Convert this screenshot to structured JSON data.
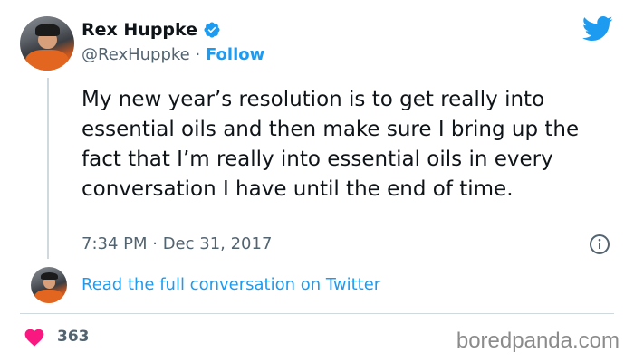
{
  "tweet": {
    "author_name": "Rex Huppke",
    "handle": "@RexHuppke",
    "separator": "·",
    "follow_label": "Follow",
    "text": "My new year’s resolution is to get really into essential oils and then make sure I bring up the fact that I’m really into essential oils in every conversation I have until the end of time.",
    "timestamp": "7:34 PM · Dec 31, 2017",
    "read_full_label": "Read the full conversation on Twitter",
    "like_count": "363"
  },
  "watermark": "boredpanda.com",
  "icons": {
    "verified": "verified-badge-icon",
    "brand": "twitter-bird-icon",
    "info": "info-icon",
    "like": "heart-icon"
  },
  "colors": {
    "accent": "#1d9bf0",
    "heart": "#f91880",
    "secondary_text": "#536471",
    "watermark": "#8b8b8b"
  }
}
